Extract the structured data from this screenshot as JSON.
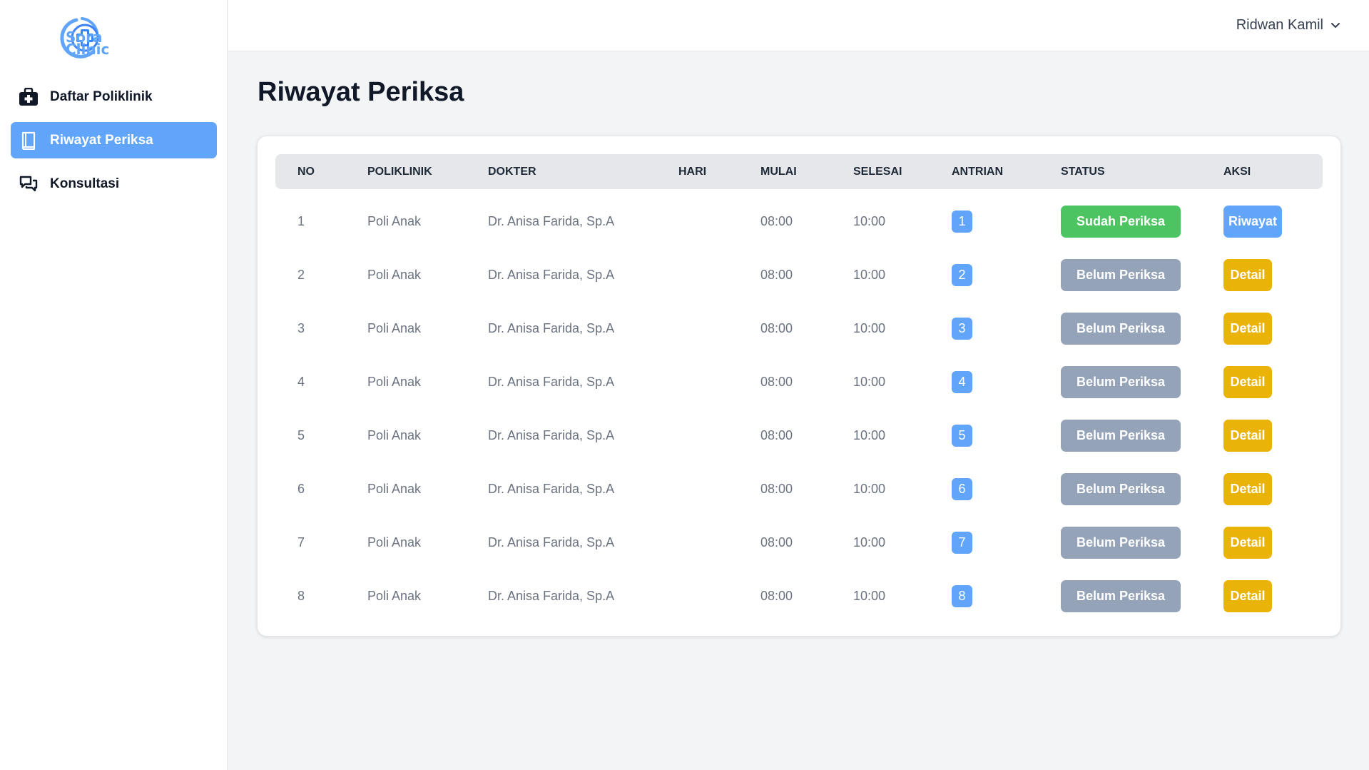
{
  "app": {
    "logo_line1": "Sora",
    "logo_line2": "Clinic"
  },
  "sidebar": {
    "items": [
      {
        "label": "Daftar Poliklinik",
        "icon": "medical-bag-icon",
        "active": false
      },
      {
        "label": "Riwayat Periksa",
        "icon": "book-icon",
        "active": true
      },
      {
        "label": "Konsultasi",
        "icon": "chat-icon",
        "active": false
      }
    ]
  },
  "header": {
    "user_name": "Ridwan Kamil"
  },
  "page": {
    "title": "Riwayat Periksa"
  },
  "table": {
    "columns": [
      "NO",
      "POLIKLINIK",
      "DOKTER",
      "HARI",
      "MULAI",
      "SELESAI",
      "ANTRIAN",
      "STATUS",
      "AKSI"
    ],
    "rows": [
      {
        "no": "1",
        "poli": "Poli Anak",
        "dokter": "Dr. Anisa Farida, Sp.A",
        "hari": "",
        "mulai": "08:00",
        "selesai": "10:00",
        "antrian": "1",
        "status": "Sudah Periksa",
        "status_type": "done",
        "aksi": "Riwayat",
        "aksi_type": "history"
      },
      {
        "no": "2",
        "poli": "Poli Anak",
        "dokter": "Dr. Anisa Farida, Sp.A",
        "hari": "",
        "mulai": "08:00",
        "selesai": "10:00",
        "antrian": "2",
        "status": "Belum Periksa",
        "status_type": "pending",
        "aksi": "Detail",
        "aksi_type": "detail"
      },
      {
        "no": "3",
        "poli": "Poli Anak",
        "dokter": "Dr. Anisa Farida, Sp.A",
        "hari": "",
        "mulai": "08:00",
        "selesai": "10:00",
        "antrian": "3",
        "status": "Belum Periksa",
        "status_type": "pending",
        "aksi": "Detail",
        "aksi_type": "detail"
      },
      {
        "no": "4",
        "poli": "Poli Anak",
        "dokter": "Dr. Anisa Farida, Sp.A",
        "hari": "",
        "mulai": "08:00",
        "selesai": "10:00",
        "antrian": "4",
        "status": "Belum Periksa",
        "status_type": "pending",
        "aksi": "Detail",
        "aksi_type": "detail"
      },
      {
        "no": "5",
        "poli": "Poli Anak",
        "dokter": "Dr. Anisa Farida, Sp.A",
        "hari": "",
        "mulai": "08:00",
        "selesai": "10:00",
        "antrian": "5",
        "status": "Belum Periksa",
        "status_type": "pending",
        "aksi": "Detail",
        "aksi_type": "detail"
      },
      {
        "no": "6",
        "poli": "Poli Anak",
        "dokter": "Dr. Anisa Farida, Sp.A",
        "hari": "",
        "mulai": "08:00",
        "selesai": "10:00",
        "antrian": "6",
        "status": "Belum Periksa",
        "status_type": "pending",
        "aksi": "Detail",
        "aksi_type": "detail"
      },
      {
        "no": "7",
        "poli": "Poli Anak",
        "dokter": "Dr. Anisa Farida, Sp.A",
        "hari": "",
        "mulai": "08:00",
        "selesai": "10:00",
        "antrian": "7",
        "status": "Belum Periksa",
        "status_type": "pending",
        "aksi": "Detail",
        "aksi_type": "detail"
      },
      {
        "no": "8",
        "poli": "Poli Anak",
        "dokter": "Dr. Anisa Farida, Sp.A",
        "hari": "",
        "mulai": "08:00",
        "selesai": "10:00",
        "antrian": "8",
        "status": "Belum Periksa",
        "status_type": "pending",
        "aksi": "Detail",
        "aksi_type": "detail"
      }
    ]
  },
  "colors": {
    "accent": "#60a5fa",
    "done": "#4cc461",
    "pending": "#94a3b8",
    "detail": "#eab308",
    "history": "#60a5fa"
  }
}
